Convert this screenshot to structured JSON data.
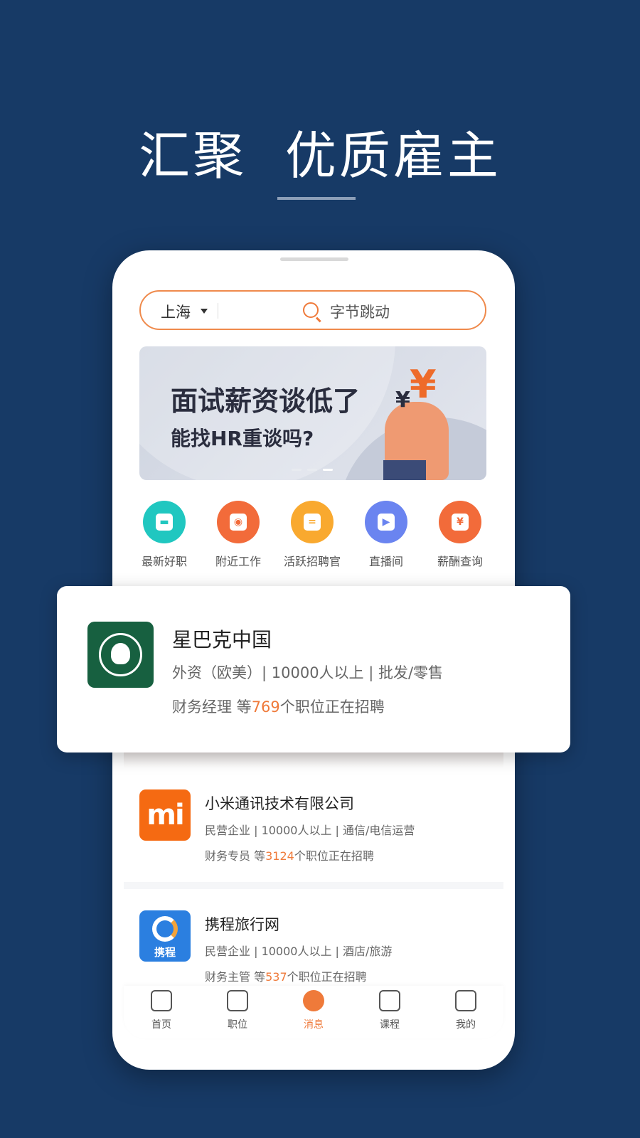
{
  "headline": "汇聚  优质雇主",
  "search": {
    "city": "上海",
    "query": "字节跳动",
    "icon": "search-icon"
  },
  "banner": {
    "line1": "面试薪资谈低了",
    "line2": "能找HR重谈吗?",
    "symbol": "¥",
    "dots": 3,
    "active_dot": 3
  },
  "quick_entries": [
    {
      "label": "最新好职",
      "icon": "calendar-icon",
      "color": "#20c7c0"
    },
    {
      "label": "附近工作",
      "icon": "location-icon",
      "color": "#f26b3a"
    },
    {
      "label": "活跃招聘官",
      "icon": "chat-icon",
      "color": "#f9a92f"
    },
    {
      "label": "直播间",
      "icon": "tv-icon",
      "color": "#6a84f0"
    },
    {
      "label": "薪酬查询",
      "icon": "salary-icon",
      "color": "#f26b3a"
    }
  ],
  "featured": {
    "name": "星巴克中国",
    "info": "外资（欧美）| 10000人以上 | 批发/零售",
    "jobs_prefix": "财务经理  等",
    "jobs_count": "769",
    "jobs_suffix": "个职位正在招聘"
  },
  "companies": [
    {
      "name": "小米通讯技术有限公司",
      "info": "民营企业 | 10000人以上 | 通信/电信运营",
      "jobs_prefix": "财务专员  等",
      "jobs_count": "3124",
      "jobs_suffix": "个职位正在招聘",
      "logo_text": "mi"
    },
    {
      "name": "携程旅行网",
      "info": "民营企业 | 10000人以上 | 酒店/旅游",
      "jobs_prefix": "财务主管  等",
      "jobs_count": "537",
      "jobs_suffix": "个职位正在招聘",
      "logo_text": "携程"
    }
  ],
  "nav": [
    {
      "label": "首页",
      "icon": "home-icon"
    },
    {
      "label": "职位",
      "icon": "briefcase-icon"
    },
    {
      "label": "消息",
      "icon": "message-icon",
      "active": true
    },
    {
      "label": "课程",
      "icon": "book-icon"
    },
    {
      "label": "我的",
      "icon": "user-icon"
    }
  ],
  "colors": {
    "background": "#173a66",
    "accent": "#ef7a3a"
  }
}
